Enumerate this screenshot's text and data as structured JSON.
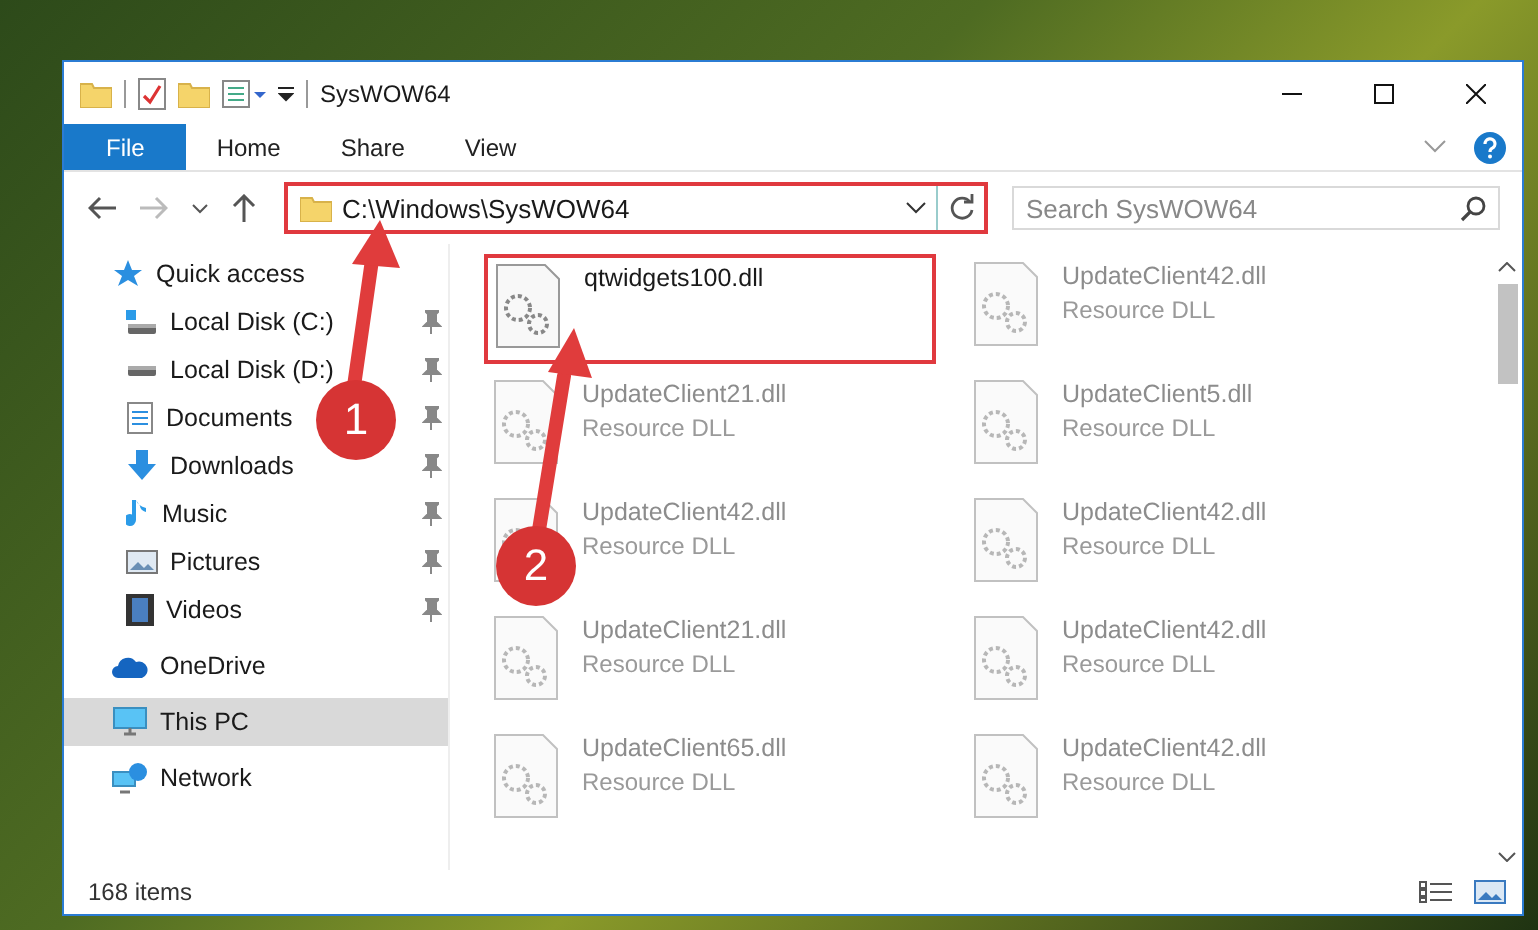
{
  "window": {
    "title": "SysWOW64"
  },
  "ribbon_tabs": [
    {
      "label": "File",
      "selected": true
    },
    {
      "label": "Home",
      "selected": false
    },
    {
      "label": "Share",
      "selected": false
    },
    {
      "label": "View",
      "selected": false
    }
  ],
  "address_bar": {
    "path": "C:\\Windows\\SysWOW64",
    "highlighted": true
  },
  "search": {
    "placeholder": "Search SysWOW64"
  },
  "navigation": [
    {
      "label": "Quick access",
      "kind": "star",
      "selected": false,
      "children": [
        {
          "label": "Local Disk (C:)",
          "kind": "system-drive",
          "selected": false,
          "pinned": true
        },
        {
          "label": "Local Disk (D:)",
          "kind": "drive",
          "selected": false,
          "pinned": true
        },
        {
          "label": "Documents",
          "kind": "document",
          "selected": false,
          "pinned": true
        },
        {
          "label": "Downloads",
          "kind": "download",
          "selected": false,
          "pinned": true
        },
        {
          "label": "Music",
          "kind": "music",
          "selected": false,
          "pinned": true
        },
        {
          "label": "Pictures",
          "kind": "picture",
          "selected": false,
          "pinned": true
        },
        {
          "label": "Videos",
          "kind": "video",
          "selected": false,
          "pinned": true
        }
      ]
    },
    {
      "label": "OneDrive",
      "kind": "cloud",
      "selected": false
    },
    {
      "label": "This PC",
      "kind": "computer",
      "selected": true
    },
    {
      "label": "Network",
      "kind": "network",
      "selected": false
    }
  ],
  "files": [
    {
      "name": "qtwidgets100.dll",
      "highlighted": true,
      "blurred": false
    },
    {
      "name": "UpdateClient42.dll",
      "type": "Resource DLL",
      "highlighted": false,
      "blurred": true
    },
    {
      "name": "UpdateClient21.dll",
      "type": "Resource DLL",
      "highlighted": false,
      "blurred": true
    },
    {
      "name": "UpdateClient5.dll",
      "type": "Resource DLL",
      "highlighted": false,
      "blurred": true
    },
    {
      "name": "UpdateClient42.dll",
      "type": "Resource DLL",
      "highlighted": false,
      "blurred": true
    },
    {
      "name": "UpdateClient42.dll",
      "type": "Resource DLL",
      "highlighted": false,
      "blurred": true
    },
    {
      "name": "UpdateClient21.dll",
      "type": "Resource DLL",
      "highlighted": false,
      "blurred": true
    },
    {
      "name": "UpdateClient42.dll",
      "type": "Resource DLL",
      "highlighted": false,
      "blurred": true
    },
    {
      "name": "UpdateClient65.dll",
      "type": "Resource DLL",
      "highlighted": false,
      "blurred": true
    },
    {
      "name": "UpdateClient42.dll",
      "type": "Resource DLL",
      "highlighted": false,
      "blurred": true
    }
  ],
  "status_bar": {
    "item_count": "168 items"
  },
  "annotations": [
    {
      "number": "1"
    },
    {
      "number": "2"
    }
  ]
}
